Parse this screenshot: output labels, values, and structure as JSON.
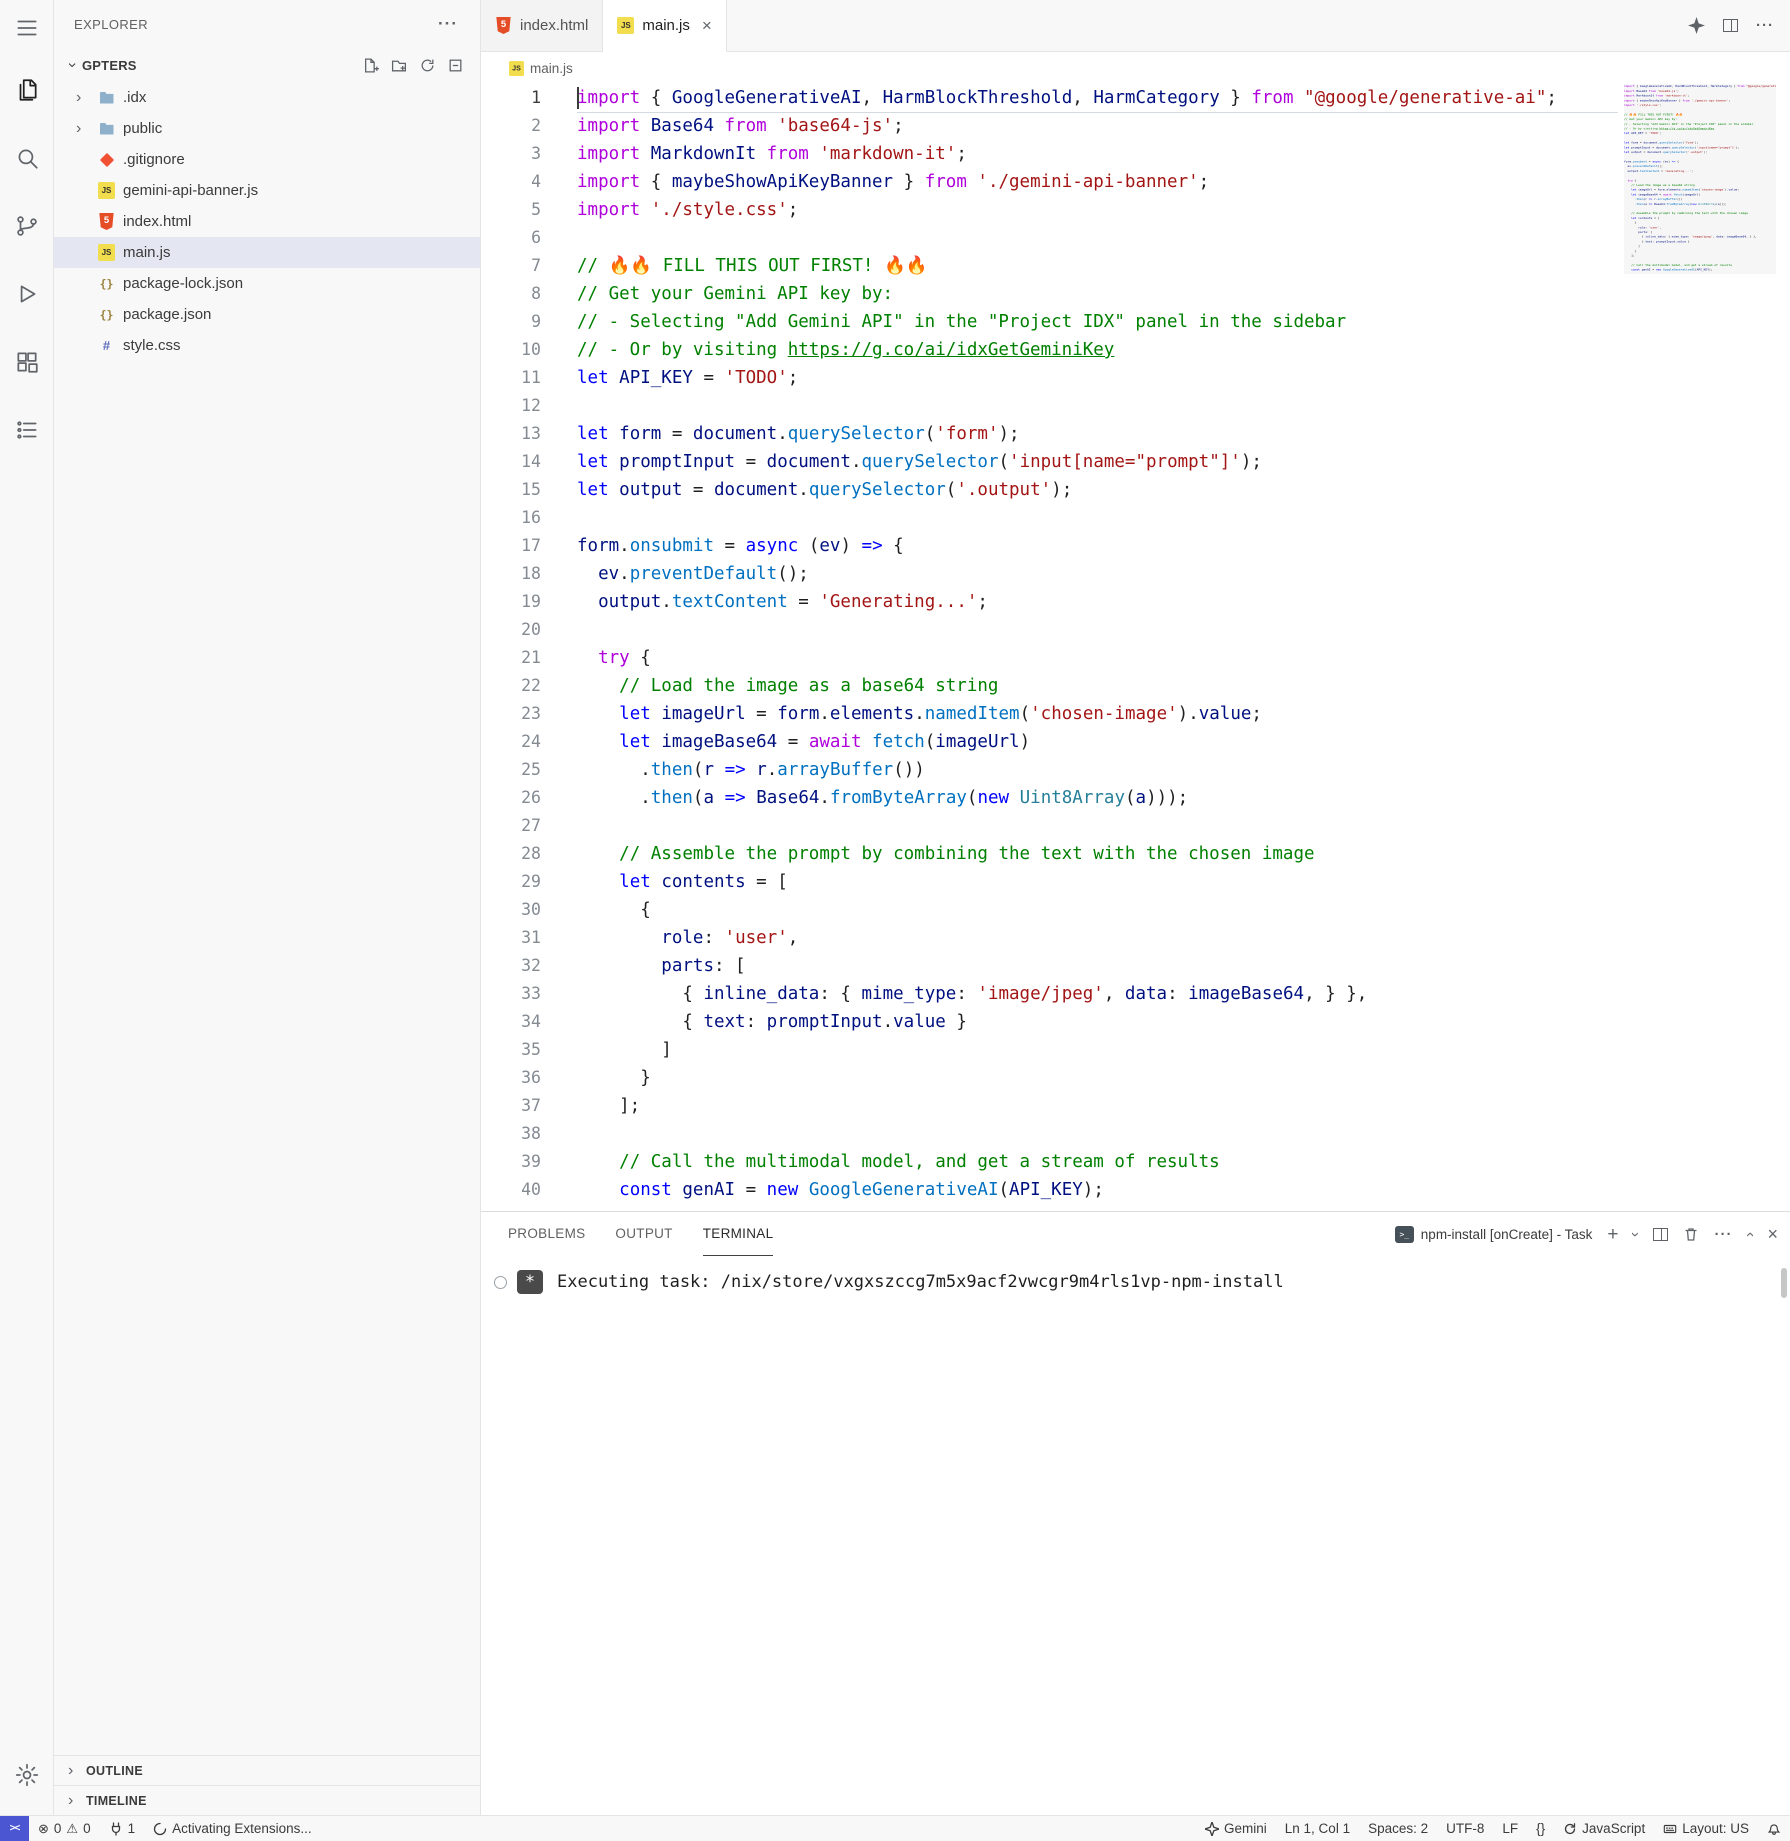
{
  "sidebar": {
    "title": "EXPLORER",
    "section": "GPTERS",
    "files": [
      {
        "name": ".idx",
        "icon": "folder",
        "chevron": true
      },
      {
        "name": "public",
        "icon": "folder",
        "chevron": true
      },
      {
        "name": ".gitignore",
        "icon": "git"
      },
      {
        "name": "gemini-api-banner.js",
        "icon": "js"
      },
      {
        "name": "index.html",
        "icon": "html"
      },
      {
        "name": "main.js",
        "icon": "js",
        "selected": true
      },
      {
        "name": "package-lock.json",
        "icon": "json"
      },
      {
        "name": "package.json",
        "icon": "json"
      },
      {
        "name": "style.css",
        "icon": "css"
      }
    ],
    "outline": "OUTLINE",
    "timeline": "TIMELINE"
  },
  "tabs": [
    {
      "label": "index.html"
    },
    {
      "label": "main.js"
    }
  ],
  "breadcrumb": {
    "label": "main.js"
  },
  "editor": {
    "lines": [
      [
        [
          "kw",
          "import "
        ],
        [
          "pn",
          "{ "
        ],
        [
          "id",
          "GoogleGenerativeAI"
        ],
        [
          "pn",
          ", "
        ],
        [
          "id",
          "HarmBlockThreshold"
        ],
        [
          "pn",
          ", "
        ],
        [
          "id",
          "HarmCategory"
        ],
        [
          "pn",
          " } "
        ],
        [
          "kw",
          "from "
        ],
        [
          "st",
          "\"@google/generative-ai\""
        ],
        [
          "pn",
          ";"
        ]
      ],
      [
        [
          "kw",
          "import "
        ],
        [
          "id",
          "Base64"
        ],
        [
          "kw",
          " from "
        ],
        [
          "st",
          "'base64-js'"
        ],
        [
          "pn",
          ";"
        ]
      ],
      [
        [
          "kw",
          "import "
        ],
        [
          "id",
          "MarkdownIt"
        ],
        [
          "kw",
          " from "
        ],
        [
          "st",
          "'markdown-it'"
        ],
        [
          "pn",
          ";"
        ]
      ],
      [
        [
          "kw",
          "import "
        ],
        [
          "pn",
          "{ "
        ],
        [
          "id",
          "maybeShowApiKeyBanner"
        ],
        [
          "pn",
          " } "
        ],
        [
          "kw",
          "from "
        ],
        [
          "st",
          "'./gemini-api-banner'"
        ],
        [
          "pn",
          ";"
        ]
      ],
      [
        [
          "kw",
          "import "
        ],
        [
          "st",
          "'./style.css'"
        ],
        [
          "pn",
          ";"
        ]
      ],
      [],
      [
        [
          "cm",
          "// 🔥🔥 FILL THIS OUT FIRST! 🔥🔥"
        ]
      ],
      [
        [
          "cm",
          "// Get your Gemini API key by:"
        ]
      ],
      [
        [
          "cm",
          "// - Selecting \"Add Gemini API\" in the \"Project IDX\" panel in the sidebar"
        ]
      ],
      [
        [
          "cm",
          "// - Or by visiting "
        ],
        [
          "lk",
          "https://g.co/ai/idxGetGeminiKey"
        ]
      ],
      [
        [
          "kb",
          "let "
        ],
        [
          "id",
          "API_KEY"
        ],
        [
          "pn",
          " = "
        ],
        [
          "st",
          "'TODO'"
        ],
        [
          "pn",
          ";"
        ]
      ],
      [],
      [
        [
          "kb",
          "let "
        ],
        [
          "id",
          "form"
        ],
        [
          "pn",
          " = "
        ],
        [
          "id",
          "document"
        ],
        [
          "pn",
          "."
        ],
        [
          "fn",
          "querySelector"
        ],
        [
          "pn",
          "("
        ],
        [
          "st",
          "'form'"
        ],
        [
          "pn",
          ");"
        ]
      ],
      [
        [
          "kb",
          "let "
        ],
        [
          "id",
          "promptInput"
        ],
        [
          "pn",
          " = "
        ],
        [
          "id",
          "document"
        ],
        [
          "pn",
          "."
        ],
        [
          "fn",
          "querySelector"
        ],
        [
          "pn",
          "("
        ],
        [
          "st",
          "'input[name=\"prompt\"]'"
        ],
        [
          "pn",
          ");"
        ]
      ],
      [
        [
          "kb",
          "let "
        ],
        [
          "id",
          "output"
        ],
        [
          "pn",
          " = "
        ],
        [
          "id",
          "document"
        ],
        [
          "pn",
          "."
        ],
        [
          "fn",
          "querySelector"
        ],
        [
          "pn",
          "("
        ],
        [
          "st",
          "'.output'"
        ],
        [
          "pn",
          ");"
        ]
      ],
      [],
      [
        [
          "id",
          "form"
        ],
        [
          "pn",
          "."
        ],
        [
          "fn",
          "onsubmit"
        ],
        [
          "pn",
          " = "
        ],
        [
          "kb",
          "async"
        ],
        [
          "pn",
          " ("
        ],
        [
          "id",
          "ev"
        ],
        [
          "pn",
          ") "
        ],
        [
          "kb",
          "=>"
        ],
        [
          "pn",
          " {"
        ]
      ],
      [
        [
          "pn",
          "  "
        ],
        [
          "id",
          "ev"
        ],
        [
          "pn",
          "."
        ],
        [
          "fn",
          "preventDefault"
        ],
        [
          "pn",
          "();"
        ]
      ],
      [
        [
          "pn",
          "  "
        ],
        [
          "id",
          "output"
        ],
        [
          "pn",
          "."
        ],
        [
          "fn",
          "textContent"
        ],
        [
          "pn",
          " = "
        ],
        [
          "st",
          "'Generating...'"
        ],
        [
          "pn",
          ";"
        ]
      ],
      [],
      [
        [
          "pn",
          "  "
        ],
        [
          "kw",
          "try"
        ],
        [
          "pn",
          " {"
        ]
      ],
      [
        [
          "pn",
          "    "
        ],
        [
          "cm",
          "// Load the image as a base64 string"
        ]
      ],
      [
        [
          "pn",
          "    "
        ],
        [
          "kb",
          "let "
        ],
        [
          "id",
          "imageUrl"
        ],
        [
          "pn",
          " = "
        ],
        [
          "id",
          "form"
        ],
        [
          "pn",
          "."
        ],
        [
          "id",
          "elements"
        ],
        [
          "pn",
          "."
        ],
        [
          "fn",
          "namedItem"
        ],
        [
          "pn",
          "("
        ],
        [
          "st",
          "'chosen-image'"
        ],
        [
          "pn",
          ")."
        ],
        [
          "id",
          "value"
        ],
        [
          "pn",
          ";"
        ]
      ],
      [
        [
          "pn",
          "    "
        ],
        [
          "kb",
          "let "
        ],
        [
          "id",
          "imageBase64"
        ],
        [
          "pn",
          " = "
        ],
        [
          "kw",
          "await "
        ],
        [
          "fn",
          "fetch"
        ],
        [
          "pn",
          "("
        ],
        [
          "id",
          "imageUrl"
        ],
        [
          "pn",
          ")"
        ]
      ],
      [
        [
          "pn",
          "      ."
        ],
        [
          "fn",
          "then"
        ],
        [
          "pn",
          "("
        ],
        [
          "id",
          "r"
        ],
        [
          "pn",
          " "
        ],
        [
          "kb",
          "=>"
        ],
        [
          "pn",
          " "
        ],
        [
          "id",
          "r"
        ],
        [
          "pn",
          "."
        ],
        [
          "fn",
          "arrayBuffer"
        ],
        [
          "pn",
          "())"
        ]
      ],
      [
        [
          "pn",
          "      ."
        ],
        [
          "fn",
          "then"
        ],
        [
          "pn",
          "("
        ],
        [
          "id",
          "a"
        ],
        [
          "pn",
          " "
        ],
        [
          "kb",
          "=>"
        ],
        [
          "pn",
          " "
        ],
        [
          "id",
          "Base64"
        ],
        [
          "pn",
          "."
        ],
        [
          "fn",
          "fromByteArray"
        ],
        [
          "pn",
          "("
        ],
        [
          "kb",
          "new "
        ],
        [
          "ty",
          "Uint8Array"
        ],
        [
          "pn",
          "("
        ],
        [
          "id",
          "a"
        ],
        [
          "pn",
          ")));"
        ]
      ],
      [],
      [
        [
          "pn",
          "    "
        ],
        [
          "cm",
          "// Assemble the prompt by combining the text with the chosen image"
        ]
      ],
      [
        [
          "pn",
          "    "
        ],
        [
          "kb",
          "let "
        ],
        [
          "id",
          "contents"
        ],
        [
          "pn",
          " = ["
        ]
      ],
      [
        [
          "pn",
          "      {"
        ]
      ],
      [
        [
          "pn",
          "        "
        ],
        [
          "id",
          "role"
        ],
        [
          "pn",
          ": "
        ],
        [
          "st",
          "'user'"
        ],
        [
          "pn",
          ","
        ]
      ],
      [
        [
          "pn",
          "        "
        ],
        [
          "id",
          "parts"
        ],
        [
          "pn",
          ": ["
        ]
      ],
      [
        [
          "pn",
          "          { "
        ],
        [
          "id",
          "inline_data"
        ],
        [
          "pn",
          ": { "
        ],
        [
          "id",
          "mime_type"
        ],
        [
          "pn",
          ": "
        ],
        [
          "st",
          "'image/jpeg'"
        ],
        [
          "pn",
          ", "
        ],
        [
          "id",
          "data"
        ],
        [
          "pn",
          ": "
        ],
        [
          "id",
          "imageBase64"
        ],
        [
          "pn",
          ", } },"
        ]
      ],
      [
        [
          "pn",
          "          { "
        ],
        [
          "id",
          "text"
        ],
        [
          "pn",
          ": "
        ],
        [
          "id",
          "promptInput"
        ],
        [
          "pn",
          "."
        ],
        [
          "id",
          "value"
        ],
        [
          "pn",
          " }"
        ]
      ],
      [
        [
          "pn",
          "        ]"
        ]
      ],
      [
        [
          "pn",
          "      }"
        ]
      ],
      [
        [
          "pn",
          "    ];"
        ]
      ],
      [],
      [
        [
          "pn",
          "    "
        ],
        [
          "cm",
          "// Call the multimodal model, and get a stream of results"
        ]
      ],
      [
        [
          "pn",
          "    "
        ],
        [
          "kb",
          "const "
        ],
        [
          "id",
          "genAI"
        ],
        [
          "pn",
          " = "
        ],
        [
          "kb",
          "new "
        ],
        [
          "fn",
          "GoogleGenerativeAI"
        ],
        [
          "pn",
          "("
        ],
        [
          "id",
          "API_KEY"
        ],
        [
          "pn",
          ");"
        ]
      ]
    ]
  },
  "panel": {
    "tabs": [
      {
        "label": "PROBLEMS"
      },
      {
        "label": "OUTPUT"
      },
      {
        "label": "TERMINAL",
        "active": true
      }
    ],
    "task": "npm-install [onCreate] - Task",
    "terminal_line": "Executing task: /nix/store/vxgxszccg7m5x9acf2vwcgr9m4rls1vp-npm-install"
  },
  "status_bar": {
    "errors": "0",
    "warnings": "0",
    "ports": "1",
    "message": "Activating Extensions...",
    "gemini": "Gemini",
    "cursor": "Ln 1, Col 1",
    "indent": "Spaces: 2",
    "encoding": "UTF-8",
    "eol": "LF",
    "braces": "{}",
    "language": "JavaScript",
    "layout": "Layout: US"
  }
}
